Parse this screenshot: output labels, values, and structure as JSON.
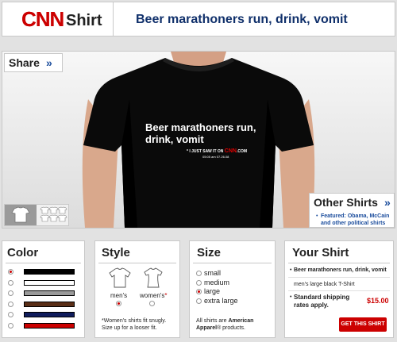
{
  "header": {
    "logo_cnn": "CNN",
    "logo_shirt": "Shirt",
    "title": "Beer marathoners run, drink, vomit"
  },
  "display": {
    "share_label": "Share",
    "share_arrow": "»",
    "shirt_text": "Beer marathoners run, drink, vomit",
    "shirt_saw_prefix": "* I JUST SAW IT ON",
    "shirt_saw_cnn": "CNN",
    "shirt_saw_suffix": ".COM",
    "shirt_time": "05:05 am 07.26.08",
    "shirt_color": "#000000"
  },
  "other_shirts": {
    "title": "Other Shirts",
    "arrow": "»",
    "bullet": "•",
    "featured": "Featured: Obama, McCain and other political shirts"
  },
  "color_panel": {
    "title": "Color",
    "swatches": [
      {
        "color": "#000000",
        "selected": true
      },
      {
        "color": "#ffffff",
        "selected": false
      },
      {
        "color": "#9a9a9a",
        "selected": false
      },
      {
        "color": "#5a2e16",
        "selected": false
      },
      {
        "color": "#101c5c",
        "selected": false
      },
      {
        "color": "#cc0000",
        "selected": false
      }
    ]
  },
  "style_panel": {
    "title": "Style",
    "mens": "men's",
    "womens": "women's",
    "womens_star": "*",
    "note": "*Women's shirts fit snugly. Size up for a looser fit."
  },
  "size_panel": {
    "title": "Size",
    "sizes": [
      {
        "label": "small",
        "selected": false
      },
      {
        "label": "medium",
        "selected": false
      },
      {
        "label": "large",
        "selected": true
      },
      {
        "label": "extra large",
        "selected": false
      }
    ],
    "note_prefix": "All shirts are ",
    "note_brand": "American Apparel",
    "note_suffix": "® products."
  },
  "your_shirt": {
    "title": "Your Shirt",
    "item_title": "Beer marathoners run, drink, vomit",
    "item_desc": "men's large black T-Shirt",
    "shipping": "Standard shipping rates apply.",
    "price": "$15.00",
    "buy_label": "GET THIS SHIRT"
  },
  "colors": {
    "cnn_red": "#cc0000",
    "navy": "#10306b",
    "link_blue": "#1a4c9c"
  }
}
